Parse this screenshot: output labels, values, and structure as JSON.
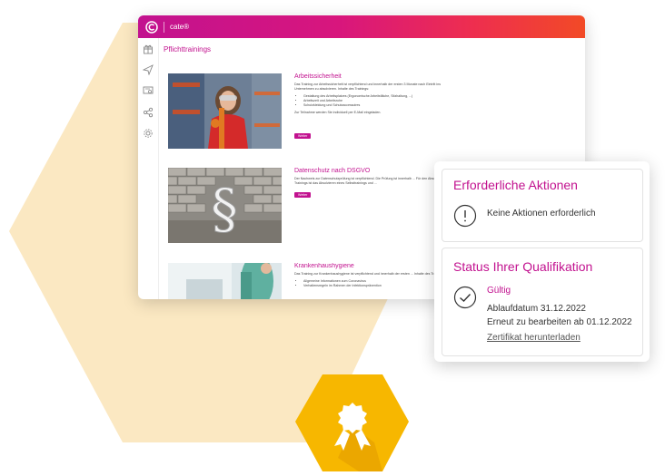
{
  "app": {
    "name": "cate®"
  },
  "page": {
    "title": "Pflichttrainings"
  },
  "trainings": [
    {
      "title": "Arbeitssicherheit",
      "intro": "Das Training zur Arbeitssicherheit ist verpflichtend und innerhalb der ersten 3 Monate nach Eintritt ins Unternehmen zu absolvieren. Inhalte des Trainings:",
      "bullets": [
        "Gestaltung des Arbeitsplatzes (Ergonomische Arbeitsfläche, Sitzhaltung, ...)",
        "Arbeitszeit und Arbeitsruhe",
        "Schutzkleidung und Schutzaccessoires"
      ],
      "note": "Zur Teilnahme werden Sie individuell per E-Mail eingeladen.",
      "button": "Weiter"
    },
    {
      "title": "Datenschutz nach DSGVO",
      "intro": "Der Nachweis zur Datenschutzprüfung ist verpflichtend. Die Prüfung ist innerhalb ... Für den Abschluss des Trainings ist das Absolvieren eines Selbsttrainings und ...",
      "button": "Weiter"
    },
    {
      "title": "Krankenhaushygiene",
      "intro": "Das Training zur Krankenhaushygiene ist verpflichtend und innerhalb der ersten ... Inhalte des Trainings:",
      "bullets": [
        "Allgemeine Informationen zum Coronavirus",
        "Verhaltensregeln im Rahmen der Infektionsprävention"
      ]
    }
  ],
  "actions": {
    "title": "Erforderliche Aktionen",
    "text": "Keine Aktionen erforderlich"
  },
  "qualification": {
    "title": "Status Ihrer Qualifikation",
    "status": "Gültig",
    "expiry": "Ablaufdatum 31.12.2022",
    "renew": "Erneut zu bearbeiten ab 01.12.2022",
    "certificate_link": "Zertifikat herunterladen"
  },
  "icons": {
    "sidebar": [
      "gift-icon",
      "send-icon",
      "certificate-icon",
      "share-icon",
      "settings-icon"
    ],
    "warning": "exclamation-circle-icon",
    "check": "check-circle-icon",
    "badge": "award-badge-icon"
  },
  "colors": {
    "accent": "#c2128f",
    "gradient_start": "#c2128f",
    "gradient_end": "#f24a26",
    "hexagon_bg": "#fbe8c2",
    "badge_gold": "#f7b700"
  }
}
